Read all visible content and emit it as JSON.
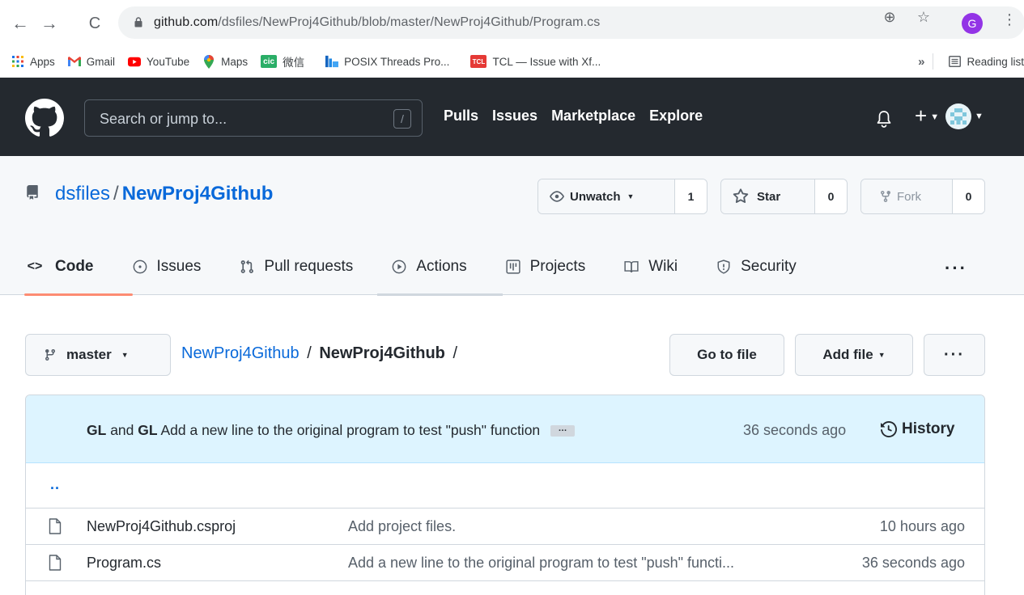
{
  "browser": {
    "url_host": "github.com",
    "url_path": "/dsfiles/NewProj4Github/blob/master/NewProj4Github/Program.cs",
    "profile_initial": "G",
    "bookmarks": [
      {
        "label": "Apps",
        "icon": "apps-grid-icon"
      },
      {
        "label": "Gmail",
        "icon": "gmail-icon"
      },
      {
        "label": "YouTube",
        "icon": "youtube-icon"
      },
      {
        "label": "Maps",
        "icon": "maps-icon"
      },
      {
        "label": "微信",
        "icon": "wechat-icon"
      },
      {
        "label": "POSIX Threads Pro...",
        "icon": "posix-icon"
      },
      {
        "label": "TCL — Issue with Xf...",
        "icon": "tcl-icon"
      }
    ],
    "overflow": "»",
    "reading_list": "Reading list"
  },
  "gh": {
    "search_placeholder": "Search or jump to...",
    "search_key": "/",
    "nav": [
      "Pulls",
      "Issues",
      "Marketplace",
      "Explore"
    ]
  },
  "repo": {
    "owner": "dsfiles",
    "sep": "/",
    "name": "NewProj4Github",
    "unwatch_label": "Unwatch",
    "unwatch_count": "1",
    "star_label": "Star",
    "star_count": "0",
    "fork_label": "Fork",
    "fork_count": "0",
    "tabs": [
      "Code",
      "Issues",
      "Pull requests",
      "Actions",
      "Projects",
      "Wiki",
      "Security"
    ],
    "more": "···"
  },
  "content": {
    "branch": "master",
    "breadcrumb_root": "NewProj4Github",
    "breadcrumb_sep": "/",
    "breadcrumb_current": "NewProj4Github",
    "breadcrumb_trail": "/",
    "goto_file": "Go to file",
    "add_file": "Add file",
    "more": "···",
    "commit": {
      "author1": "GL",
      "and": "and",
      "author2": "GL",
      "message": "Add a new line to the original program to test \"push\" function",
      "ellipsis": "…",
      "time": "36 seconds ago",
      "history": "History"
    },
    "parent": "..",
    "files": [
      {
        "name": "NewProj4Github.csproj",
        "message": "Add project files.",
        "age": "10 hours ago"
      },
      {
        "name": "Program.cs",
        "message": "Add a new line to the original program to test \"push\" functi...",
        "age": "36 seconds ago"
      }
    ]
  },
  "colors": {
    "header_bg": "#24292f",
    "link": "#0969da",
    "active_tab": "#fd8c73",
    "commit_bg": "#ddf4ff"
  }
}
